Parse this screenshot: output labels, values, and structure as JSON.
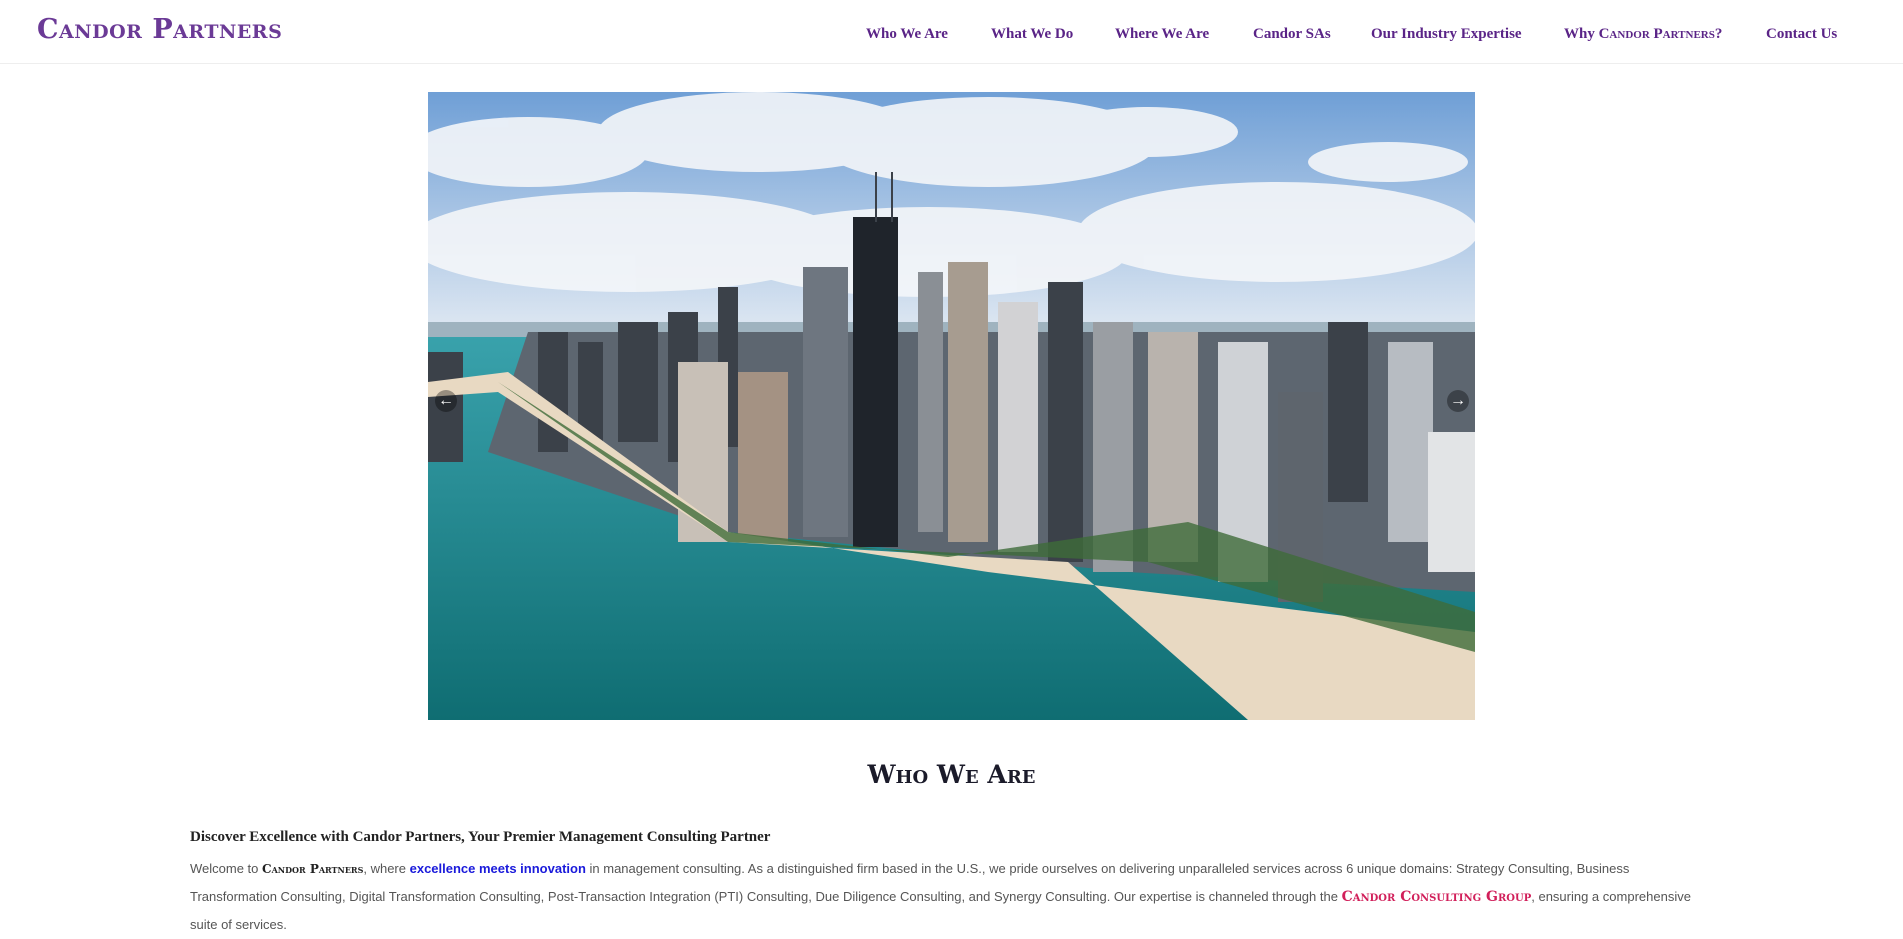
{
  "header": {
    "logo": "Candor Partners",
    "nav": [
      "Who We Are",
      "What We Do",
      "Where We Are",
      "Candor SAs",
      "Our Industry Expertise",
      "Why ",
      "Candor Partners",
      "?",
      "Contact Us"
    ]
  },
  "hero": {
    "image": "Aerial view of city skyline by lakeshore",
    "prev_icon": "arrow-left-icon",
    "next_icon": "arrow-right-icon",
    "prev": "←",
    "next": "→"
  },
  "section": {
    "title": "Who We Are",
    "subtitle": "Discover Excellence with Candor Partners, Your Premier Management Consulting Partner",
    "p1": "Welcome to ",
    "brand": "Candor Partners",
    "p2": ", where ",
    "highlight": "excellence meets innovation",
    "p3": " in management consulting. As a distinguished firm based in the U.S., we pride ourselves on delivering unparalleled services across 6 unique domains: Strategy Consulting, Business Transformation Consulting, Digital Transformation Consulting, Post-Transaction Integration (PTI) Consulting, Due Diligence Consulting, and Synergy Consulting. Our expertise is channeled through the ",
    "group": "Candor Consulting Group",
    "p4": ", ensuring a comprehensive suite of services."
  },
  "colors": {
    "brand": "#6b3a96",
    "nav": "#5a2487",
    "highlight": "#1a1adb",
    "group": "#d11f5a"
  }
}
